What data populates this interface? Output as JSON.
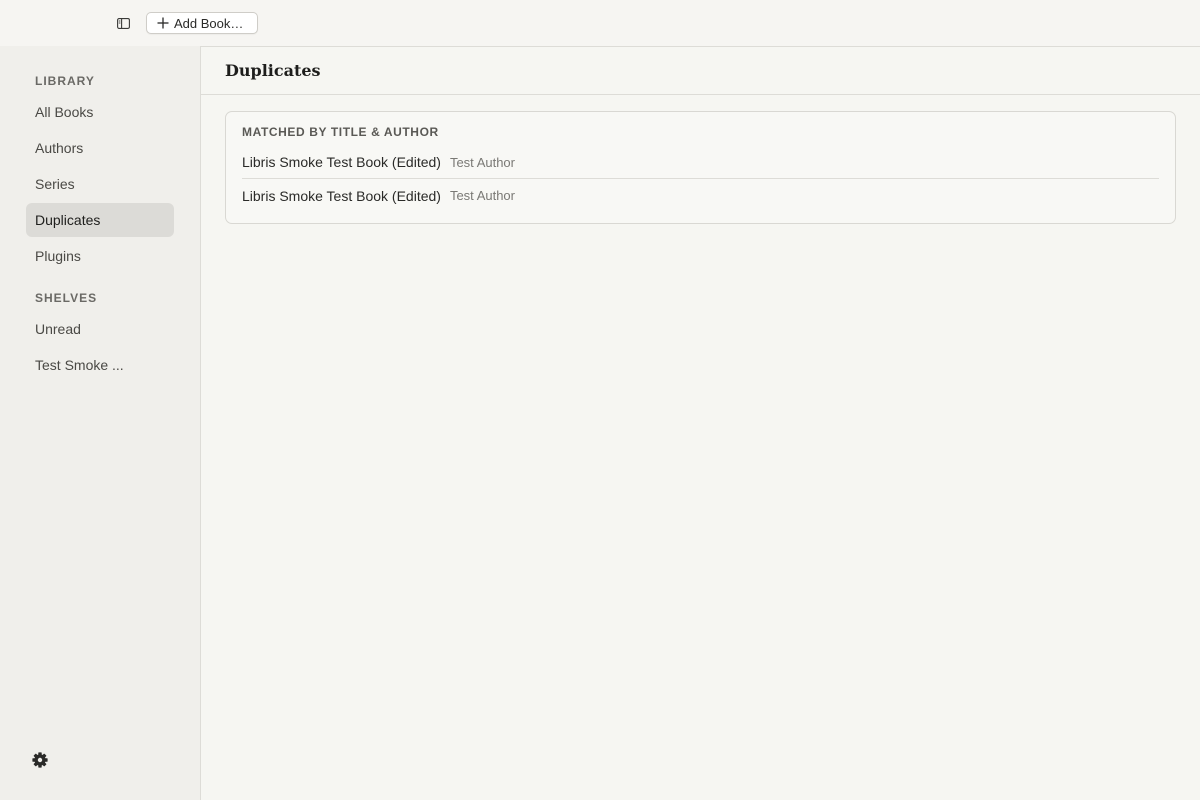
{
  "toolbar": {
    "toggle_icon": "sidebar-toggle-icon",
    "add_book_label": "Add Book…",
    "add_icon": "plus-icon"
  },
  "sidebar": {
    "library_label": "LIBRARY",
    "library_items": [
      {
        "label": "All Books",
        "active": false
      },
      {
        "label": "Authors",
        "active": false
      },
      {
        "label": "Series",
        "active": false
      },
      {
        "label": "Duplicates",
        "active": true
      },
      {
        "label": "Plugins",
        "active": false
      }
    ],
    "shelves_label": "SHELVES",
    "shelf_items": [
      {
        "label": "Unread"
      },
      {
        "label": "Test Smoke ..."
      }
    ],
    "settings_icon": "gear-icon"
  },
  "main": {
    "title": "Duplicates",
    "groups": [
      {
        "header": "MATCHED BY TITLE & AUTHOR",
        "books": [
          {
            "title": "Libris Smoke Test Book (Edited)",
            "author": "Test Author"
          },
          {
            "title": "Libris Smoke Test Book (Edited)",
            "author": "Test Author"
          }
        ]
      }
    ]
  },
  "colors": {
    "sidebar_bg": "#f0efeb",
    "main_bg": "#f6f6f2",
    "active_item_bg": "#dcdbd7",
    "border": "#dddcd7"
  }
}
